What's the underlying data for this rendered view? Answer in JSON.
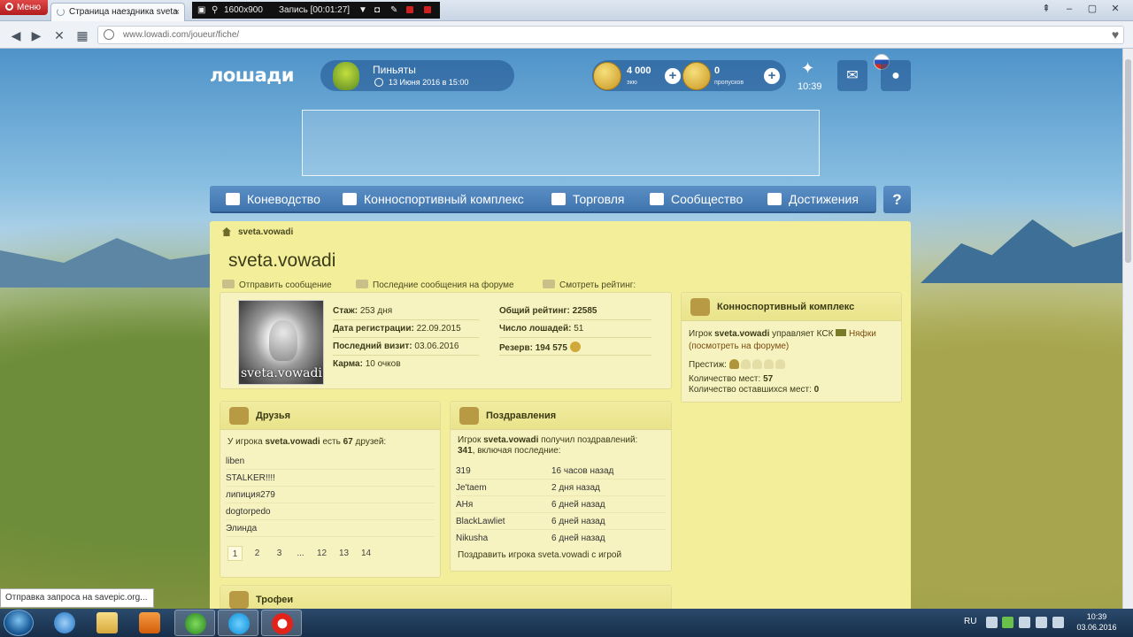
{
  "browser": {
    "menu_label": "Меню",
    "tab_title": "Страница наездника sveta",
    "recorder": {
      "resolution": "1600x900",
      "status": "Запись [00:01:27]"
    },
    "url": "www.lowadi.com/joueur/fiche/"
  },
  "header": {
    "logo": "лошади",
    "event": {
      "title": "Пиньяты",
      "date": "13 Июня 2016 в 15:00"
    },
    "currency": [
      {
        "value": "4 000",
        "label": "экю"
      },
      {
        "value": "0",
        "label": "пропусков"
      }
    ],
    "time": "10:39"
  },
  "nav": {
    "items": [
      "Коневодство",
      "Конноспортивный комплекс",
      "Торговля",
      "Сообщество",
      "Достижения"
    ],
    "help": "?"
  },
  "profile": {
    "breadcrumb": "sveta.vowadi",
    "title": "sveta.vowadi",
    "actions": [
      "Отправить сообщение",
      "Последние сообщения на форуме",
      "Смотреть рейтинг:"
    ],
    "avatar_caption": "sveta.vowadi",
    "stats_left": [
      {
        "label": "Стаж:",
        "value": "253 дня"
      },
      {
        "label": "Дата регистрации:",
        "value": "22.09.2015"
      },
      {
        "label": "Последний визит:",
        "value": "03.06.2016"
      },
      {
        "label": "Карма:",
        "value": "10 очков"
      }
    ],
    "stats_right": [
      {
        "label": "Общий рейтинг:",
        "value": "22585"
      },
      {
        "label": "Число лошадей:",
        "value": "51"
      },
      {
        "label": "Резерв:",
        "value": "194 575"
      }
    ]
  },
  "ksk": {
    "title": "Конноспортивный комплекс",
    "line1_prefix": "Игрок",
    "player": "sveta.vowadi",
    "line1_mid": "управляет КСК",
    "club": "Няфки",
    "forum_link": "(посмотреть на форуме)",
    "prestige_label": "Престиж:",
    "prestige_level": 1,
    "prestige_max": 5,
    "places_label": "Количество мест:",
    "places": "57",
    "remaining_label": "Количество оставшихся мест:",
    "remaining": "0"
  },
  "friends": {
    "title": "Друзья",
    "desc_prefix": "У игрока",
    "player": "sveta.vowadi",
    "desc_mid": "есть",
    "count": "67",
    "desc_suffix": "друзей:",
    "list": [
      "liben",
      "STALKER!!!!",
      "липиция279",
      "dogtorpedo",
      "Элинда"
    ],
    "pages": [
      "1",
      "2",
      "3",
      "...",
      "12",
      "13",
      "14"
    ]
  },
  "congrats": {
    "title": "Поздравления",
    "desc_prefix": "Игрок",
    "player": "sveta.vowadi",
    "desc_mid": "получил поздравлений:",
    "count": "341",
    "desc_suffix": ", включая последние:",
    "rows": [
      {
        "name": "319",
        "time": "16 часов назад"
      },
      {
        "name": "Je'taem",
        "time": "2 дня назад"
      },
      {
        "name": "АНя",
        "time": "6 дней назад"
      },
      {
        "name": "BlackLawliet",
        "time": "6 дней назад"
      },
      {
        "name": "Nikusha",
        "time": "6 дней назад"
      }
    ],
    "link": "Поздравить игрока sveta.vowadi с игрой"
  },
  "trophies": {
    "title": "Трофеи"
  },
  "status_text": "Отправка запроса на savepic.org...",
  "taskbar": {
    "lang": "RU",
    "clock_time": "10:39",
    "clock_date": "03.06.2016"
  }
}
